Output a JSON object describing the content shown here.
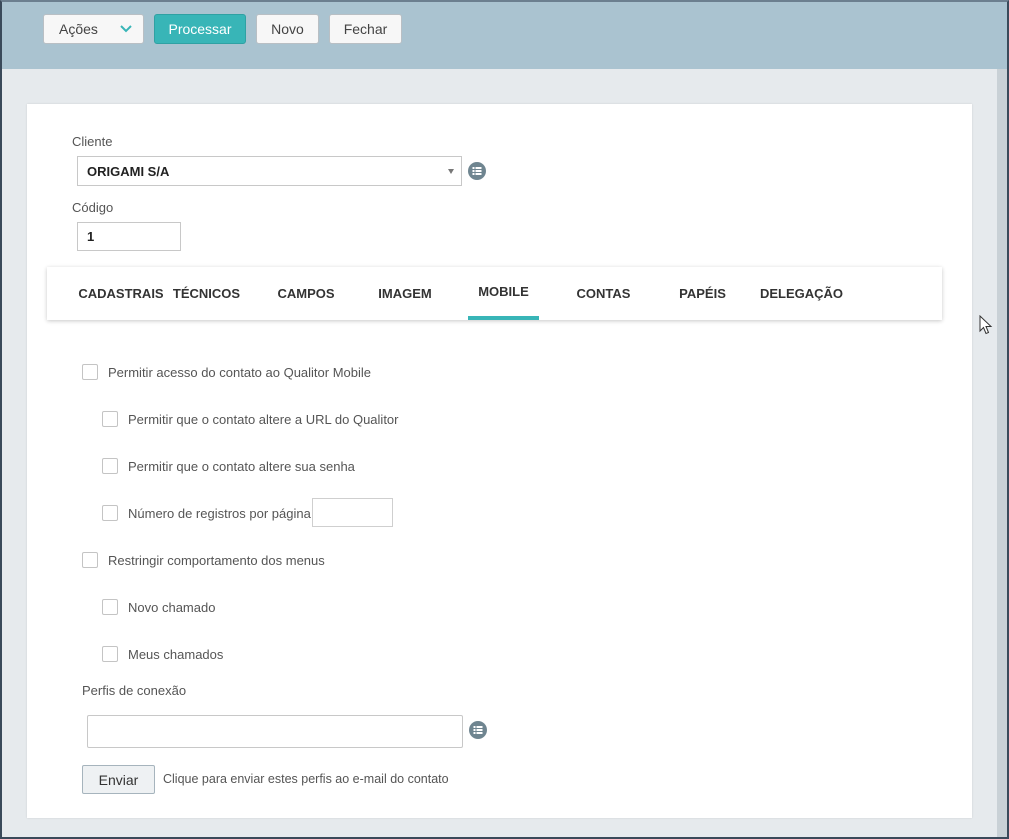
{
  "toolbar": {
    "acoes_label": "Ações",
    "processar_label": "Processar",
    "novo_label": "Novo",
    "fechar_label": "Fechar"
  },
  "form": {
    "cliente_label": "Cliente",
    "cliente_value": "ORIGAMI S/A",
    "codigo_label": "Código",
    "codigo_value": "1"
  },
  "tabs": [
    {
      "label": "CADASTRAIS"
    },
    {
      "label": "TÉCNICOS"
    },
    {
      "label": "CAMPOS"
    },
    {
      "label": "IMAGEM"
    },
    {
      "label": "MOBILE",
      "active": true
    },
    {
      "label": "CONTAS"
    },
    {
      "label": "PAPÉIS"
    },
    {
      "label": "DELEGAÇÃO"
    }
  ],
  "mobile": {
    "permitir_acesso": "Permitir acesso do contato ao Qualitor Mobile",
    "alterar_url": "Permitir que o contato altere a URL do Qualitor",
    "alterar_senha": "Permitir que o contato altere sua senha",
    "num_registros": "Número de registros por página",
    "num_registros_value": "",
    "restringir_menus": "Restringir comportamento dos menus",
    "novo_chamado": "Novo chamado",
    "meus_chamados": "Meus chamados",
    "perfis_label": "Perfis de conexão",
    "perfis_value": "",
    "enviar_label": "Enviar",
    "enviar_hint": "Clique para enviar estes perfis ao e-mail do contato"
  },
  "colors": {
    "accent": "#38b5b7",
    "toolbar_bg": "#aac3d0",
    "icon": "#6f8590"
  },
  "icons": [
    "chevron-down-icon",
    "list-icon",
    "mouse-cursor-icon"
  ]
}
